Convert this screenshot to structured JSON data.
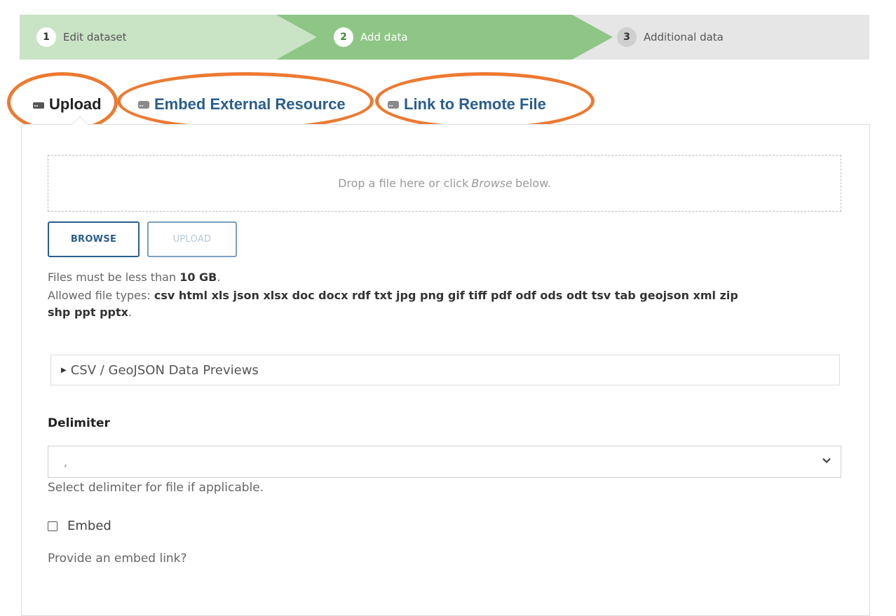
{
  "wizard": {
    "steps": [
      {
        "num": "1",
        "label": "Edit dataset"
      },
      {
        "num": "2",
        "label": "Add data"
      },
      {
        "num": "3",
        "label": "Additional data"
      }
    ]
  },
  "tabs": {
    "upload": "Upload",
    "embed": "Embed External Resource",
    "link": "Link to Remote File"
  },
  "dropzone": {
    "before": "Drop a file here or click",
    "emphasis": "Browse",
    "after": "below."
  },
  "buttons": {
    "browse": "BROWSE",
    "upload": "UPLOAD"
  },
  "limits": {
    "size_prefix": "Files must be less than",
    "size_value": "10 GB",
    "size_suffix": ".",
    "types_prefix": "Allowed file types:",
    "types_line1": "csv html xls json xlsx doc docx rdf txt jpg png gif tiff pdf odf ods odt tsv tab geojson xml zip",
    "types_line2": "shp ppt pptx",
    "types_suffix": "."
  },
  "preview": {
    "label": "CSV / GeoJSON Data Previews"
  },
  "delimiter": {
    "label": "Delimiter",
    "selected": ",",
    "hint": "Select delimiter for file if applicable."
  },
  "embed_option": {
    "label": "Embed",
    "hint": "Provide an embed link?"
  },
  "colors": {
    "accent": "#2a5e8c",
    "annotation": "#ec7a31",
    "step_active": "#8dc685",
    "step_done": "#c9e3c5"
  }
}
